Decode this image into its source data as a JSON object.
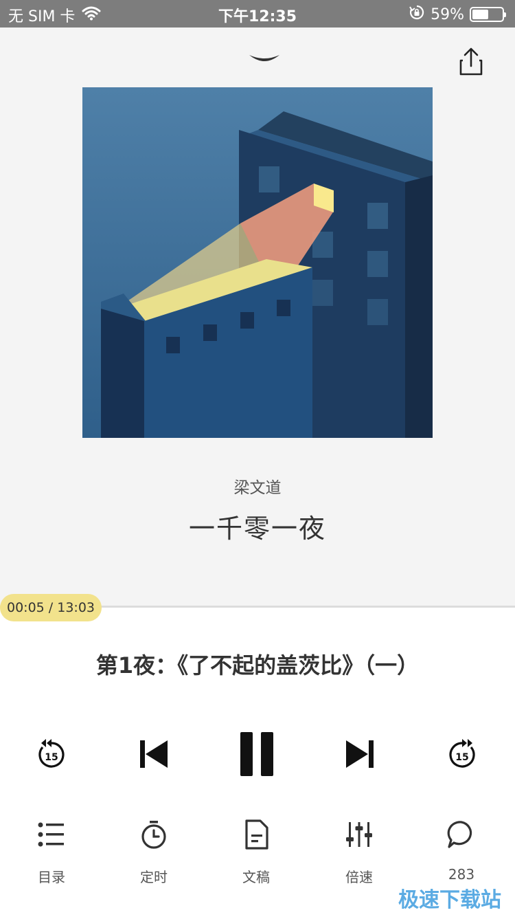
{
  "status_bar": {
    "carrier": "无 SIM 卡",
    "time": "下午12:35",
    "battery_percent": "59%",
    "battery_level": 0.59
  },
  "player": {
    "author": "梁文道",
    "book_title": "一千零一夜",
    "elapsed": "00:05",
    "total": "13:03",
    "time_display": "00:05 / 13:03",
    "progress_fraction": 0.006,
    "chapter_title": "第1夜：《了不起的盖茨比》（一）",
    "rewind_seconds": "15",
    "forward_seconds": "15"
  },
  "toolbar": [
    {
      "label": "目录",
      "icon": "list-icon"
    },
    {
      "label": "定时",
      "icon": "timer-icon"
    },
    {
      "label": "文稿",
      "icon": "document-icon"
    },
    {
      "label": "倍速",
      "icon": "speed-sliders-icon"
    },
    {
      "label": "283",
      "icon": "comment-icon"
    }
  ],
  "watermark": "极速下载站",
  "colors": {
    "accent": "#f2e28c",
    "cover_bg": "#4a7ba3"
  }
}
